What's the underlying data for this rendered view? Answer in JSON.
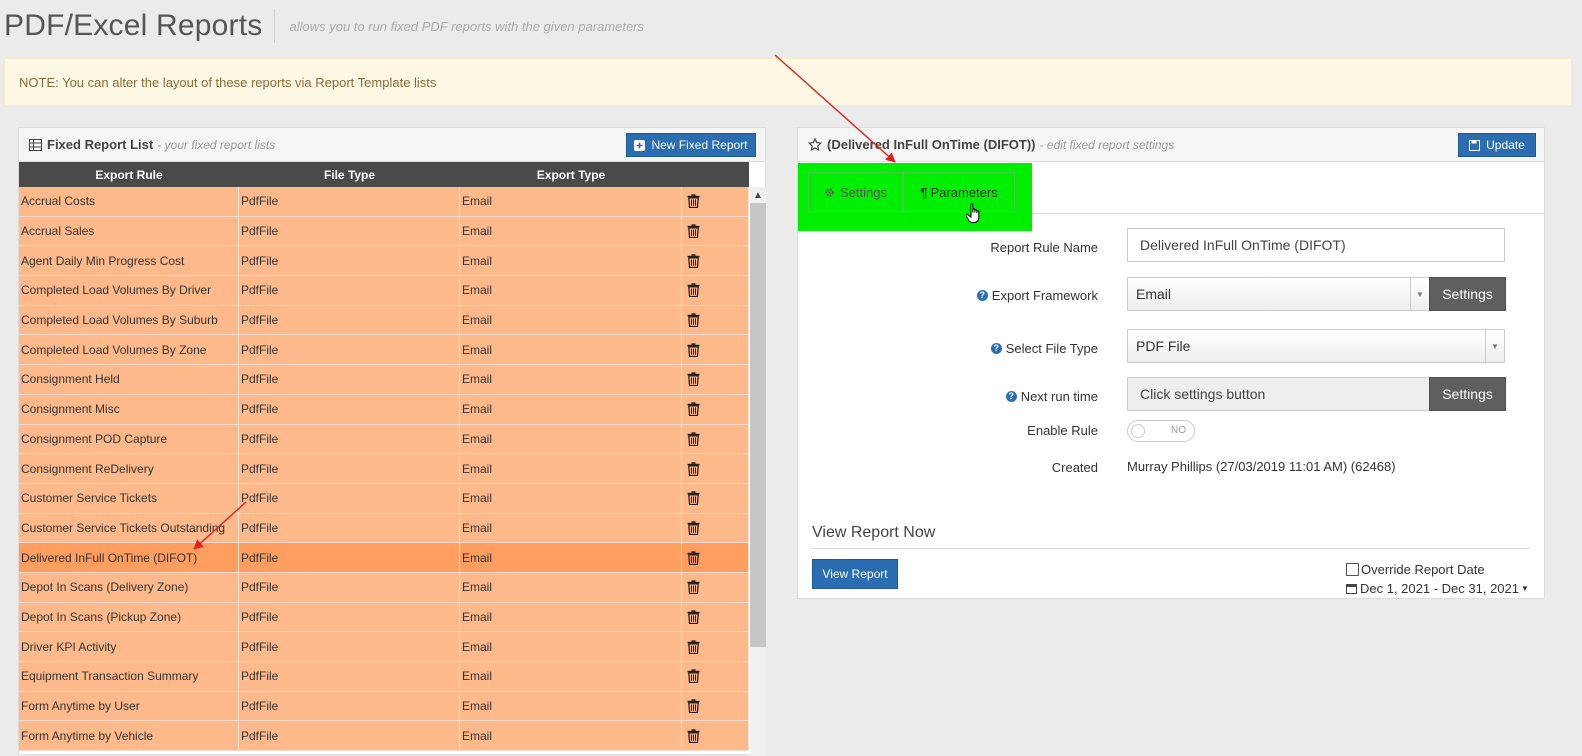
{
  "page": {
    "title": "PDF/Excel Reports",
    "subtitle": "allows you to run fixed PDF reports with the given parameters"
  },
  "note": "NOTE: You can alter the layout of these reports via Report Template lists",
  "left_panel": {
    "title": "Fixed Report List",
    "subtitle": "- your fixed report lists",
    "new_button": "New Fixed Report",
    "columns": [
      "Export Rule",
      "File Type",
      "Export Type"
    ],
    "rows": [
      {
        "rule": "Accrual Costs",
        "file": "PdfFile",
        "export": "Email"
      },
      {
        "rule": "Accrual Sales",
        "file": "PdfFile",
        "export": "Email"
      },
      {
        "rule": "Agent Daily Min Progress Cost",
        "file": "PdfFile",
        "export": "Email"
      },
      {
        "rule": "Completed Load Volumes By Driver",
        "file": "PdfFile",
        "export": "Email"
      },
      {
        "rule": "Completed Load Volumes By Suburb",
        "file": "PdfFile",
        "export": "Email"
      },
      {
        "rule": "Completed Load Volumes By Zone",
        "file": "PdfFile",
        "export": "Email"
      },
      {
        "rule": "Consignment Held",
        "file": "PdfFile",
        "export": "Email"
      },
      {
        "rule": "Consignment Misc",
        "file": "PdfFile",
        "export": "Email"
      },
      {
        "rule": "Consignment POD Capture",
        "file": "PdfFile",
        "export": "Email"
      },
      {
        "rule": "Consignment ReDelivery",
        "file": "PdfFile",
        "export": "Email"
      },
      {
        "rule": "Customer Service Tickets",
        "file": "PdfFile",
        "export": "Email"
      },
      {
        "rule": "Customer Service Tickets Outstanding",
        "file": "PdfFile",
        "export": "Email"
      },
      {
        "rule": "Delivered InFull OnTime (DIFOT)",
        "file": "PdfFile",
        "export": "Email",
        "selected": true
      },
      {
        "rule": "Depot In Scans (Delivery Zone)",
        "file": "PdfFile",
        "export": "Email"
      },
      {
        "rule": "Depot In Scans (Pickup Zone)",
        "file": "PdfFile",
        "export": "Email"
      },
      {
        "rule": "Driver KPI Activity",
        "file": "PdfFile",
        "export": "Email"
      },
      {
        "rule": "Equipment Transaction Summary",
        "file": "PdfFile",
        "export": "Email"
      },
      {
        "rule": "Form Anytime by User",
        "file": "PdfFile",
        "export": "Email"
      },
      {
        "rule": "Form Anytime by Vehicle",
        "file": "PdfFile",
        "export": "Email"
      }
    ]
  },
  "right_panel": {
    "title": "(Delivered InFull OnTime (DIFOT))",
    "subtitle": "- edit fixed report settings",
    "update_button": "Update",
    "tabs": {
      "settings": "Settings",
      "parameters": "Parameters"
    },
    "form": {
      "rule_name_label": "Report Rule Name",
      "rule_name_value": "Delivered InFull OnTime (DIFOT)",
      "framework_label": "Export Framework",
      "framework_value": "Email",
      "framework_button": "Settings",
      "file_type_label": "Select File Type",
      "file_type_value": "PDF File",
      "next_run_label": "Next run time",
      "next_run_value": "Click settings button",
      "next_run_button": "Settings",
      "enable_label": "Enable Rule",
      "enable_value": "NO",
      "created_label": "Created",
      "created_value": "Murray Phillips (27/03/2019 11:01 AM) (62468)"
    },
    "view_now": {
      "heading": "View Report Now",
      "button": "View Report",
      "override_label": "Override Report Date",
      "date_range": "Dec 1, 2021 - Dec 31, 2021"
    }
  },
  "colors": {
    "row": "#ffb98a",
    "row_selected": "#ff9e5e",
    "highlight": "#00ee00",
    "primary": "#2a6db1",
    "annotation_arrow": "#e02020"
  }
}
